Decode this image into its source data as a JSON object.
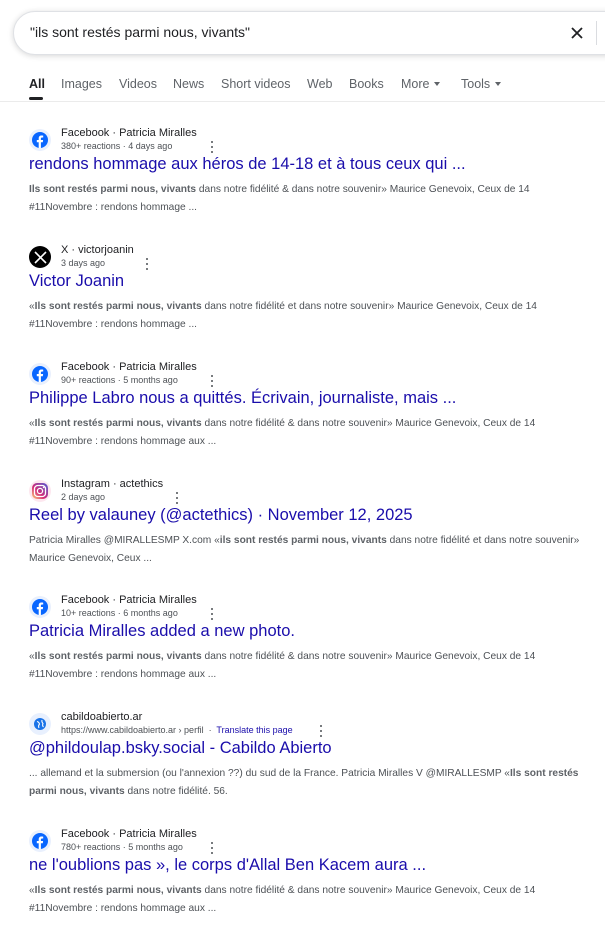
{
  "search": {
    "query": "\"ils sont restés parmi nous, vivants\""
  },
  "tabs": [
    {
      "label": "All"
    },
    {
      "label": "Images"
    },
    {
      "label": "Videos"
    },
    {
      "label": "News"
    },
    {
      "label": "Short videos"
    },
    {
      "label": "Web"
    },
    {
      "label": "Books"
    },
    {
      "label": "More"
    },
    {
      "label": "Tools"
    }
  ],
  "results": [
    {
      "icon": "facebook-icon",
      "source": "Facebook · Patricia Miralles",
      "meta": "380+ reactions · 4 days ago",
      "title": "rendons hommage aux héros de 14-18 et à tous ceux qui ...",
      "snippet_bold": "Ils sont restés parmi nous, vivants",
      "snippet_pre": "",
      "snippet_post": " dans notre fidélité & dans notre souvenir» Maurice Genevoix, Ceux de 14 #11Novembre : rendons hommage ..."
    },
    {
      "icon": "x-icon",
      "source": "X · victorjoanin",
      "meta": "3 days ago",
      "title": "Victor Joanin",
      "snippet_pre": "«",
      "snippet_bold": "Ils sont restés parmi nous, vivants",
      "snippet_post": " dans notre fidélité et dans notre souvenir» Maurice Genevoix, Ceux de 14 #11Novembre : rendons hommage ..."
    },
    {
      "icon": "facebook-icon",
      "source": "Facebook · Patricia Miralles",
      "meta": "90+ reactions · 5 months ago",
      "title": "Philippe Labro nous a quittés. Écrivain, journaliste, mais ...",
      "snippet_pre": "«",
      "snippet_bold": "Ils sont restés parmi nous, vivants",
      "snippet_post": " dans notre fidélité & dans notre souvenir» Maurice Genevoix, Ceux de 14 #11Novembre : rendons hommage aux ..."
    },
    {
      "icon": "instagram-icon",
      "source": "Instagram · actethics",
      "meta": "2 days ago",
      "title": "Reel by valauney (@actethics) · November 12, 2025",
      "snippet_pre": "Patricia Miralles @MIRALLESMP X.com «",
      "snippet_bold": "ils sont restés parmi nous, vivants",
      "snippet_post": " dans notre fidélité et dans notre souvenir» Maurice Genevoix, Ceux ..."
    },
    {
      "icon": "facebook-icon",
      "source": "Facebook · Patricia Miralles",
      "meta": "10+ reactions · 6 months ago",
      "title": "Patricia Miralles added a new photo.",
      "snippet_pre": "«",
      "snippet_bold": "Ils sont restés parmi nous, vivants",
      "snippet_post": " dans notre fidélité & dans notre souvenir» Maurice Genevoix, Ceux de 14 #11Novembre : rendons hommage aux ..."
    },
    {
      "icon": "globe-icon",
      "source": "cabildoabierto.ar",
      "meta": "https://www.cabildoabierto.ar › perfil",
      "translate": "Translate this page",
      "title": "@phildoulap.bsky.social - Cabildo Abierto",
      "snippet_pre": "... allemand et la submersion (ou l'annexion ??) du sud de la France. Patricia Miralles V @MIRALLESMP «",
      "snippet_bold": "Ils sont restés parmi nous, vivants",
      "snippet_post": " dans notre fidélité. 56."
    },
    {
      "icon": "facebook-icon",
      "source": "Facebook · Patricia Miralles",
      "meta": "780+ reactions · 5 months ago",
      "title": "ne l'oublions pas », le corps d'Allal Ben Kacem aura ...",
      "snippet_pre": "«",
      "snippet_bold": "Ils sont restés parmi nous, vivants",
      "snippet_post": " dans notre fidélité & dans notre souvenir» Maurice Genevoix, Ceux de 14 #11Novembre : rendons hommage aux ..."
    }
  ],
  "colors": {
    "link": "#1a0dab",
    "facebook": "#0866ff",
    "snippet": "#4d5156"
  }
}
